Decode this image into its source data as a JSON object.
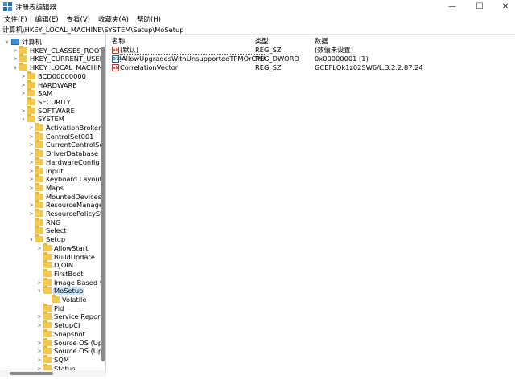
{
  "window": {
    "title": "注册表编辑器",
    "minimize_glyph": "—",
    "maximize_glyph": "☐",
    "close_glyph": "✕"
  },
  "menu": [
    "文件(F)",
    "编辑(E)",
    "查看(V)",
    "收藏夹(A)",
    "帮助(H)"
  ],
  "address": "计算机\\HKEY_LOCAL_MACHINE\\SYSTEM\\Setup\\MoSetup",
  "tree": [
    {
      "label": "计算机",
      "level": 0,
      "expander": "∨",
      "icon": "computer-icon"
    },
    {
      "label": "HKEY_CLASSES_ROOT",
      "level": 1,
      "expander": ">",
      "icon": "folder-icon"
    },
    {
      "label": "HKEY_CURRENT_USER",
      "level": 1,
      "expander": ">",
      "icon": "folder-icon"
    },
    {
      "label": "HKEY_LOCAL_MACHINE",
      "level": 1,
      "expander": "∨",
      "icon": "folder-icon"
    },
    {
      "label": "BCD00000000",
      "level": 2,
      "expander": ">",
      "icon": "folder-icon"
    },
    {
      "label": "HARDWARE",
      "level": 2,
      "expander": ">",
      "icon": "folder-icon"
    },
    {
      "label": "SAM",
      "level": 2,
      "expander": ">",
      "icon": "folder-icon"
    },
    {
      "label": "SECURITY",
      "level": 2,
      "expander": "",
      "icon": "folder-icon"
    },
    {
      "label": "SOFTWARE",
      "level": 2,
      "expander": ">",
      "icon": "folder-icon"
    },
    {
      "label": "SYSTEM",
      "level": 2,
      "expander": "∨",
      "icon": "folder-icon"
    },
    {
      "label": "ActivationBroker",
      "level": 3,
      "expander": ">",
      "icon": "folder-icon"
    },
    {
      "label": "ControlSet001",
      "level": 3,
      "expander": ">",
      "icon": "folder-icon"
    },
    {
      "label": "CurrentControlSet",
      "level": 3,
      "expander": ">",
      "icon": "folder-icon"
    },
    {
      "label": "DriverDatabase",
      "level": 3,
      "expander": ">",
      "icon": "folder-icon"
    },
    {
      "label": "HardwareConfig",
      "level": 3,
      "expander": ">",
      "icon": "folder-icon"
    },
    {
      "label": "Input",
      "level": 3,
      "expander": ">",
      "icon": "folder-icon"
    },
    {
      "label": "Keyboard Layout",
      "level": 3,
      "expander": ">",
      "icon": "folder-icon"
    },
    {
      "label": "Maps",
      "level": 3,
      "expander": ">",
      "icon": "folder-icon"
    },
    {
      "label": "MountedDevices",
      "level": 3,
      "expander": "",
      "icon": "folder-icon"
    },
    {
      "label": "ResourceManager",
      "level": 3,
      "expander": ">",
      "icon": "folder-icon"
    },
    {
      "label": "ResourcePolicyStore",
      "level": 3,
      "expander": ">",
      "icon": "folder-icon"
    },
    {
      "label": "RNG",
      "level": 3,
      "expander": "",
      "icon": "folder-icon"
    },
    {
      "label": "Select",
      "level": 3,
      "expander": "",
      "icon": "folder-icon"
    },
    {
      "label": "Setup",
      "level": 3,
      "expander": "∨",
      "icon": "folder-icon"
    },
    {
      "label": "AllowStart",
      "level": 4,
      "expander": ">",
      "icon": "folder-icon"
    },
    {
      "label": "BuildUpdate",
      "level": 4,
      "expander": "",
      "icon": "folder-icon"
    },
    {
      "label": "DJOIN",
      "level": 4,
      "expander": "",
      "icon": "folder-icon"
    },
    {
      "label": "FirstBoot",
      "level": 4,
      "expander": "",
      "icon": "folder-icon"
    },
    {
      "label": "Image Based Setup",
      "level": 4,
      "expander": ">",
      "icon": "folder-icon"
    },
    {
      "label": "MoSetup",
      "level": 4,
      "expander": "∨",
      "icon": "folder-icon",
      "selected": true
    },
    {
      "label": "Volatile",
      "level": 5,
      "expander": "",
      "icon": "folder-icon"
    },
    {
      "label": "Pid",
      "level": 4,
      "expander": "",
      "icon": "folder-icon"
    },
    {
      "label": "Service Reporting API",
      "level": 4,
      "expander": ">",
      "icon": "folder-icon"
    },
    {
      "label": "SetupCI",
      "level": 4,
      "expander": ">",
      "icon": "folder-icon"
    },
    {
      "label": "Snapshot",
      "level": 4,
      "expander": "",
      "icon": "folder-icon"
    },
    {
      "label": "Source OS (Updated",
      "level": 4,
      "expander": ">",
      "icon": "folder-icon"
    },
    {
      "label": "Source OS (Updated",
      "level": 4,
      "expander": ">",
      "icon": "folder-icon"
    },
    {
      "label": "SQM",
      "level": 4,
      "expander": ">",
      "icon": "folder-icon"
    },
    {
      "label": "Status",
      "level": 4,
      "expander": ">",
      "icon": "folder-icon"
    }
  ],
  "columns": {
    "name": "名称",
    "type": "类型",
    "data": "数据"
  },
  "values": [
    {
      "name": "(默认)",
      "type": "REG_SZ",
      "data": "(数值未设置)",
      "icon": "string-value-icon",
      "icon_text": "ab"
    },
    {
      "name": "AllowUpgradesWithUnsupportedTPMOrCPU",
      "type": "REG_DWORD",
      "data": "0x00000001 (1)",
      "icon": "dword-value-icon",
      "icon_text": "011",
      "selected": true
    },
    {
      "name": "CorrelationVector",
      "type": "REG_SZ",
      "data": "GCEFLQk1z02SW6/L.3.2.2.87.24",
      "icon": "string-value-icon",
      "icon_text": "ab"
    }
  ]
}
